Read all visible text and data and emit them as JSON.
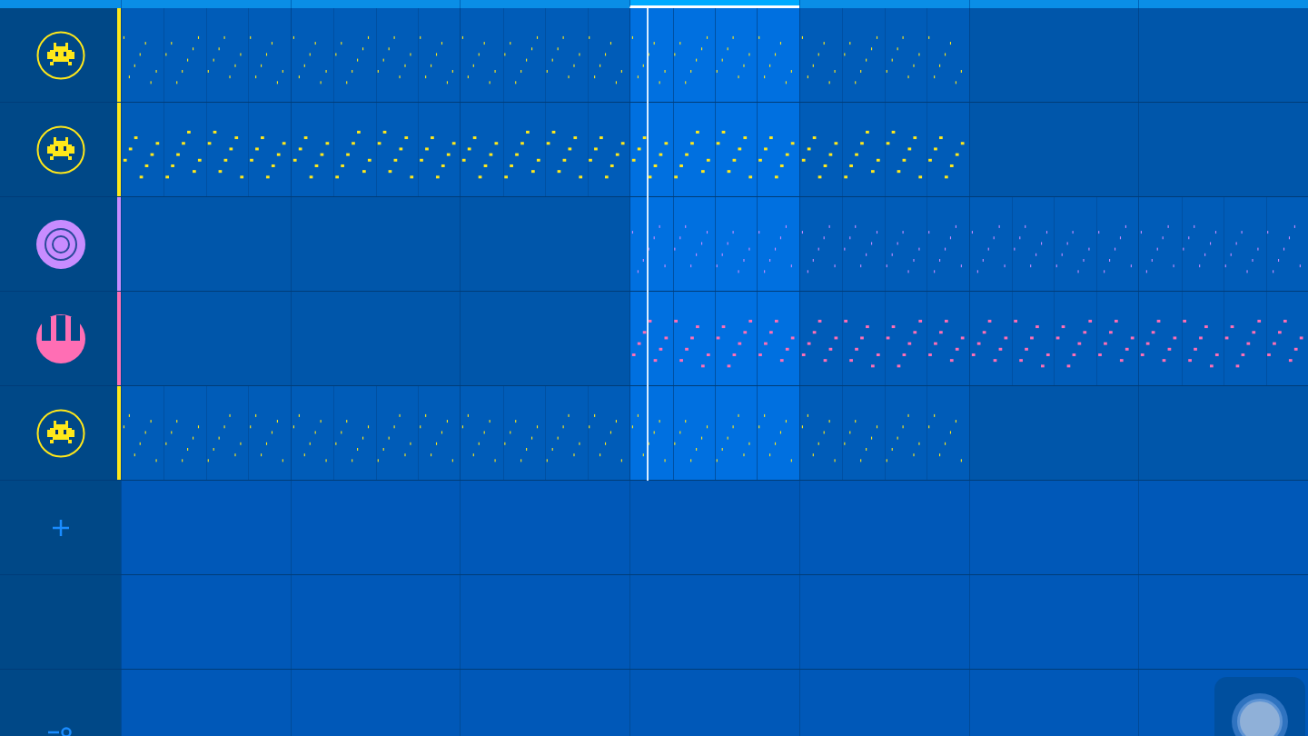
{
  "timeline": {
    "sections": [
      {
        "selected": false
      },
      {
        "selected": false
      },
      {
        "selected": false
      },
      {
        "selected": true
      },
      {
        "selected": false
      },
      {
        "selected": false
      },
      {
        "selected": false
      }
    ]
  },
  "tracks": [
    {
      "kind": "alien",
      "color": "#ffe81a",
      "clips": [
        {
          "filled": true
        },
        {
          "filled": true
        },
        {
          "filled": true
        },
        {
          "filled": true
        },
        {
          "filled": true
        },
        {
          "filled": false
        },
        {
          "filled": false
        }
      ]
    },
    {
      "kind": "alien",
      "color": "#ffe81a",
      "clips": [
        {
          "filled": true
        },
        {
          "filled": true
        },
        {
          "filled": true
        },
        {
          "filled": true
        },
        {
          "filled": true
        },
        {
          "filled": false
        },
        {
          "filled": false
        }
      ]
    },
    {
      "kind": "drum",
      "color": "#c88cff",
      "clips": [
        {
          "filled": false
        },
        {
          "filled": false
        },
        {
          "filled": false
        },
        {
          "filled": true
        },
        {
          "filled": true
        },
        {
          "filled": true
        },
        {
          "filled": true
        }
      ]
    },
    {
      "kind": "keys",
      "color": "#ff6eb4",
      "clips": [
        {
          "filled": false
        },
        {
          "filled": false
        },
        {
          "filled": false
        },
        {
          "filled": true
        },
        {
          "filled": true
        },
        {
          "filled": true
        },
        {
          "filled": true
        }
      ]
    },
    {
      "kind": "alien",
      "color": "#ffe81a",
      "clips": [
        {
          "filled": true
        },
        {
          "filled": true
        },
        {
          "filled": true
        },
        {
          "filled": true
        },
        {
          "filled": true
        },
        {
          "filled": false
        },
        {
          "filled": false
        }
      ]
    }
  ]
}
